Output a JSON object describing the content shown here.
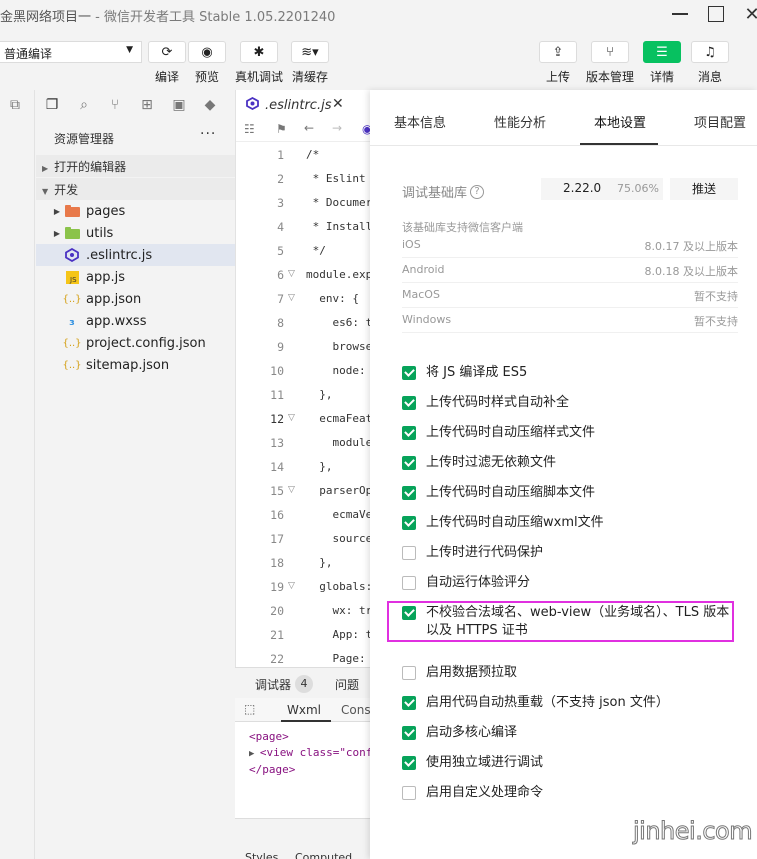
{
  "window": {
    "title_project": "金黑网络项目一",
    "title_app": " - 微信开发者工具 Stable 1.05.2201240"
  },
  "toolbar": {
    "mode": "普通编译",
    "compile": "编译",
    "preview": "预览",
    "remote_debug": "真机调试",
    "clear_cache": "清缓存",
    "upload": "上传",
    "version": "版本管理",
    "details": "详情",
    "messages": "消息"
  },
  "explorer": {
    "header": "资源管理器",
    "more": "···",
    "open_editors": "打开的编辑器",
    "dev": "开发",
    "items": [
      {
        "name": "pages",
        "type": "folder"
      },
      {
        "name": "utils",
        "type": "folder"
      },
      {
        "name": ".eslintrc.js",
        "type": "eslint"
      },
      {
        "name": "app.js",
        "type": "js"
      },
      {
        "name": "app.json",
        "type": "json"
      },
      {
        "name": "app.wxss",
        "type": "wxss"
      },
      {
        "name": "project.config.json",
        "type": "json"
      },
      {
        "name": "sitemap.json",
        "type": "json"
      }
    ]
  },
  "editor": {
    "tab": ".eslintrc.js",
    "lines": [
      {
        "n": "1",
        "code": "/*"
      },
      {
        "n": "2",
        "code": " * Eslint"
      },
      {
        "n": "3",
        "code": " * Documer"
      },
      {
        "n": "4",
        "code": " * Install"
      },
      {
        "n": "5",
        "code": " */"
      },
      {
        "n": "6",
        "code": "module.exp"
      },
      {
        "n": "7",
        "code": "  env: {"
      },
      {
        "n": "8",
        "code": "    es6: t"
      },
      {
        "n": "9",
        "code": "    browse"
      },
      {
        "n": "10",
        "code": "    node:"
      },
      {
        "n": "11",
        "code": "  },"
      },
      {
        "n": "12",
        "code": "  ecmaFeat"
      },
      {
        "n": "13",
        "code": "    module"
      },
      {
        "n": "14",
        "code": "  },"
      },
      {
        "n": "15",
        "code": "  parserOp"
      },
      {
        "n": "16",
        "code": "    ecmaVe"
      },
      {
        "n": "17",
        "code": "    source"
      },
      {
        "n": "18",
        "code": "  },"
      },
      {
        "n": "19",
        "code": "  globals:"
      },
      {
        "n": "20",
        "code": "    wx: tr"
      },
      {
        "n": "21",
        "code": "    App: t"
      },
      {
        "n": "22",
        "code": "    Page:"
      }
    ]
  },
  "debugger": {
    "tab": "调试器",
    "badge": "4",
    "issues": "问题",
    "wxml": "Wxml",
    "console": "Cons",
    "xml": [
      "<page>",
      "<view class=\"conf",
      "</page>"
    ],
    "styles": "Styles",
    "computed": "Computed"
  },
  "settings": {
    "tabs": [
      "基本信息",
      "性能分析",
      "本地设置",
      "项目配置"
    ],
    "lib_label": "调试基础库",
    "lib_version": "2.22.0",
    "lib_percent": "75.06%",
    "push": "推送",
    "client_header": "该基础库支持微信客户端",
    "platforms": [
      {
        "name": "iOS",
        "req": "8.0.17 及以上版本"
      },
      {
        "name": "Android",
        "req": "8.0.18 及以上版本"
      },
      {
        "name": "MacOS",
        "req": "暂不支持"
      },
      {
        "name": "Windows",
        "req": "暂不支持"
      }
    ],
    "options": [
      {
        "label": "将 JS 编译成 ES5",
        "checked": true
      },
      {
        "label": "上传代码时样式自动补全",
        "checked": true
      },
      {
        "label": "上传代码时自动压缩样式文件",
        "checked": true
      },
      {
        "label": "上传时过滤无依赖文件",
        "checked": true
      },
      {
        "label": "上传代码时自动压缩脚本文件",
        "checked": true
      },
      {
        "label": "上传代码时自动压缩wxml文件",
        "checked": true
      },
      {
        "label": "上传时进行代码保护",
        "checked": false
      },
      {
        "label": "自动运行体验评分",
        "checked": false
      },
      {
        "label": "不校验合法域名、web-view（业务域名）、TLS 版本以及 HTTPS 证书",
        "checked": true
      },
      {
        "label": "启用数据预拉取",
        "checked": false
      },
      {
        "label": "启用代码自动热重载（不支持 json 文件）",
        "checked": true
      },
      {
        "label": "启动多核心编译",
        "checked": true
      },
      {
        "label": "使用独立域进行调试",
        "checked": true
      },
      {
        "label": "启用自定义处理命令",
        "checked": false
      }
    ]
  },
  "watermark": "jinhei.com",
  "colors": {
    "accent_green": "#07c160",
    "checkbox_green": "#07a35a",
    "highlight": "#e030e0"
  }
}
